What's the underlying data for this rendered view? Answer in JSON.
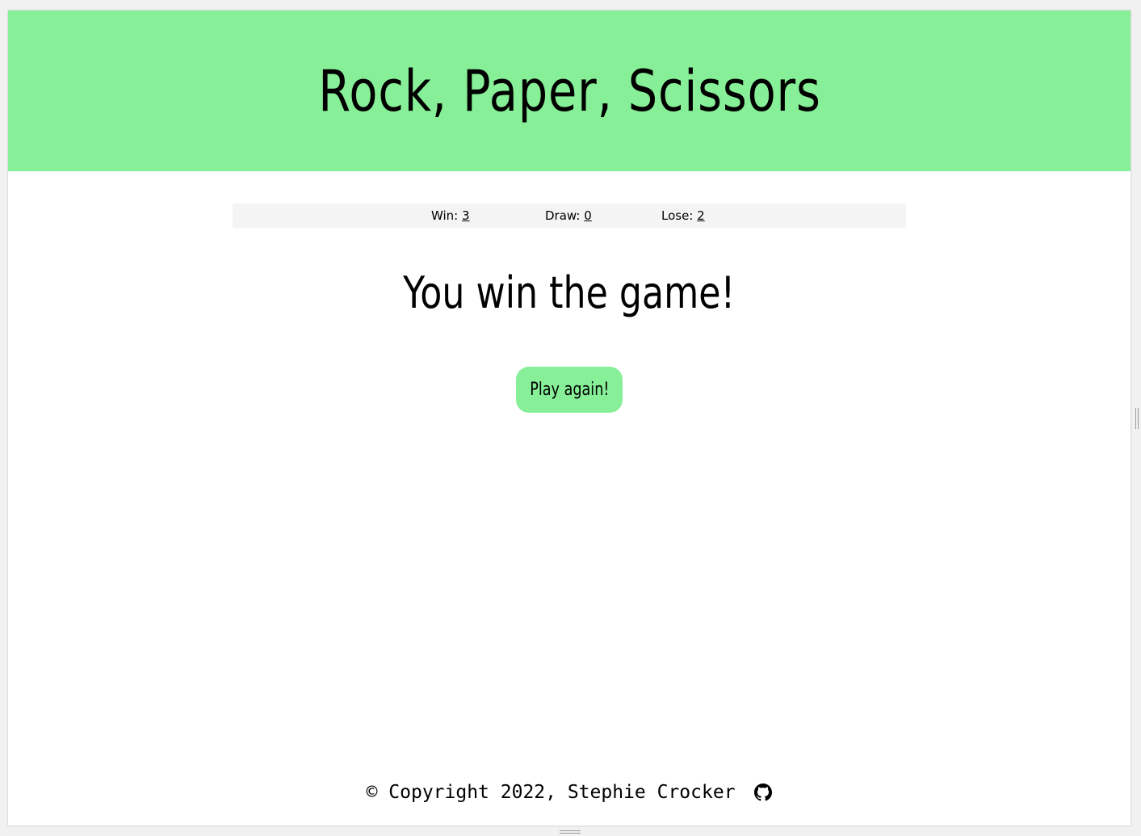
{
  "header": {
    "title": "Rock, Paper, Scissors"
  },
  "scoreboard": {
    "win_label": "Win:",
    "win_value": "3",
    "draw_label": "Draw:",
    "draw_value": "0",
    "lose_label": "Lose:",
    "lose_value": "2"
  },
  "result": {
    "message": "You win the game!"
  },
  "actions": {
    "play_again_label": "Play again!"
  },
  "footer": {
    "copyright": "© Copyright 2022, Stephie Crocker",
    "icon": "github-icon"
  },
  "colors": {
    "accent": "#86ef97",
    "scoreboard_bg": "#f4f4f4",
    "text": "#000000"
  }
}
